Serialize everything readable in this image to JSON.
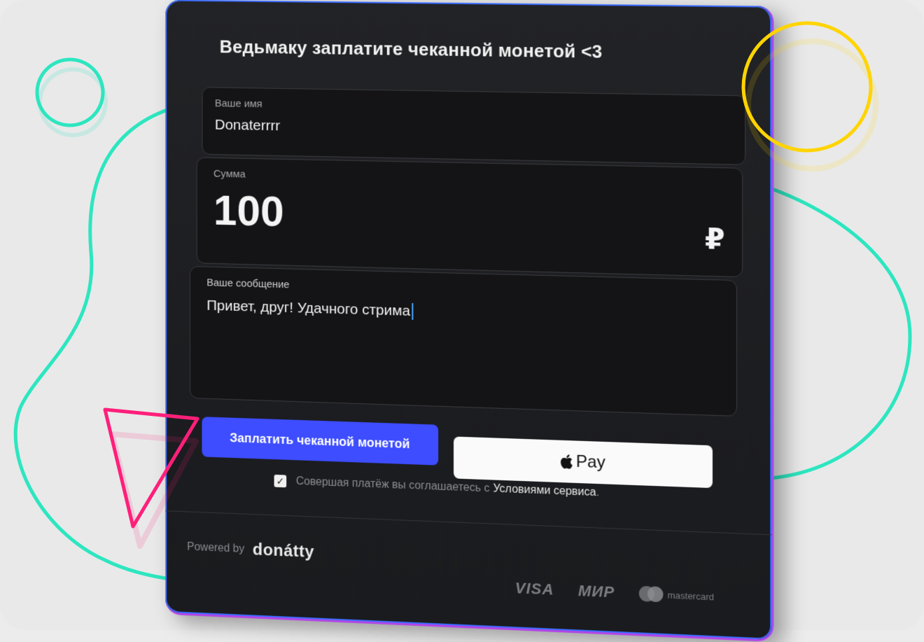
{
  "form": {
    "title": "Ведьмаку заплатите чеканной монетой <3",
    "name_label": "Ваше имя",
    "name_value": "Donaterrrr",
    "amount_label": "Сумма",
    "amount_value": "100",
    "currency_symbol": "₽",
    "message_label": "Ваше сообщение",
    "message_value": "Привет, друг! Удачного стрима",
    "pay_button_label": "Заплатить чеканной монетой",
    "apple_pay_label": "Pay",
    "agreement_text": "Совершая платёж вы соглашаетесь с",
    "terms_link": "Условиями сервиса",
    "terms_suffix": ".",
    "agreement_checked": true
  },
  "footer": {
    "powered_by": "Powered by",
    "brand": "donátty",
    "payment_systems": [
      "VISA",
      "МИР",
      "mastercard"
    ]
  },
  "colors": {
    "accent": "#3d4dff",
    "teal": "#2de6c0",
    "yellow": "#ffd400",
    "pink": "#ff1f7a",
    "card_bg": "#1e1f22"
  }
}
